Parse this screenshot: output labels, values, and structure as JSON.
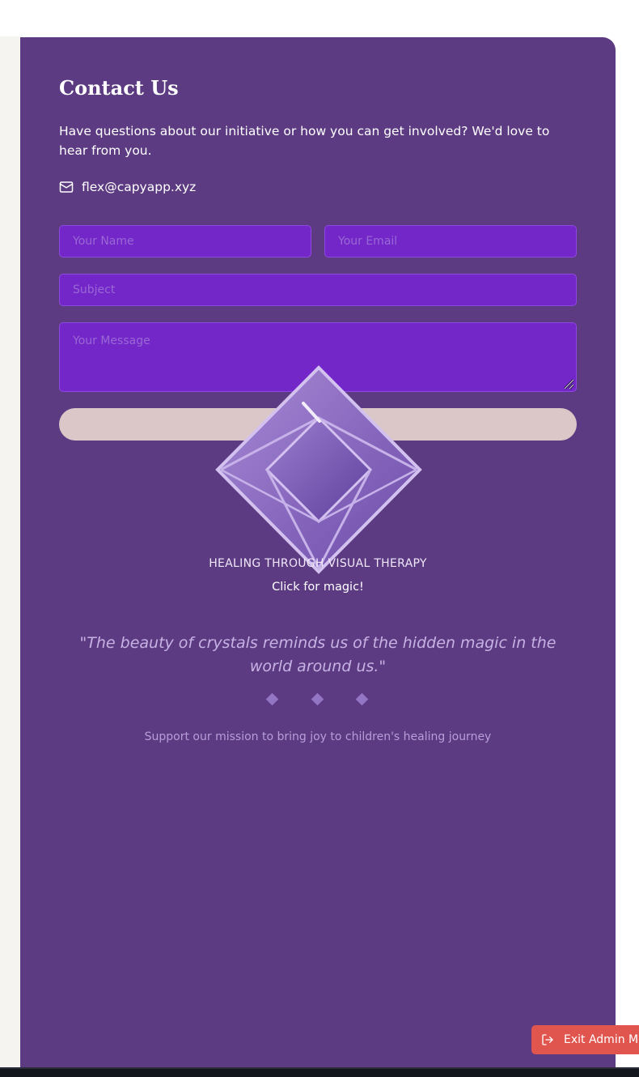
{
  "contact": {
    "title": "Contact Us",
    "intro": "Have questions about our initiative or how you can get involved? We'd love to hear from you.",
    "email": "flex@capyapp.xyz",
    "email_icon": "mail-icon"
  },
  "form": {
    "name_placeholder": "Your Name",
    "email_placeholder": "Your Email",
    "subject_placeholder": "Subject",
    "message_placeholder": "Your Message",
    "send_label": ""
  },
  "crystal": {
    "icon": "crystal-icon",
    "tagline": "HEALING THROUGH VISUAL THERAPY",
    "cta": "Click for magic!"
  },
  "quote": {
    "text": "\"The beauty of crystals reminds us of the hidden magic in the world around us.\""
  },
  "support_text": "Support our mission to bring joy to children's healing journey",
  "admin": {
    "exit_label": "Exit Admin Mode",
    "exit_icon": "logout-icon"
  },
  "colors": {
    "panel_bg": "#5c3b82",
    "input_bg": "#7327c9",
    "send_button_bg": "#dbc7c7",
    "exit_button_bg": "#e0564f"
  }
}
